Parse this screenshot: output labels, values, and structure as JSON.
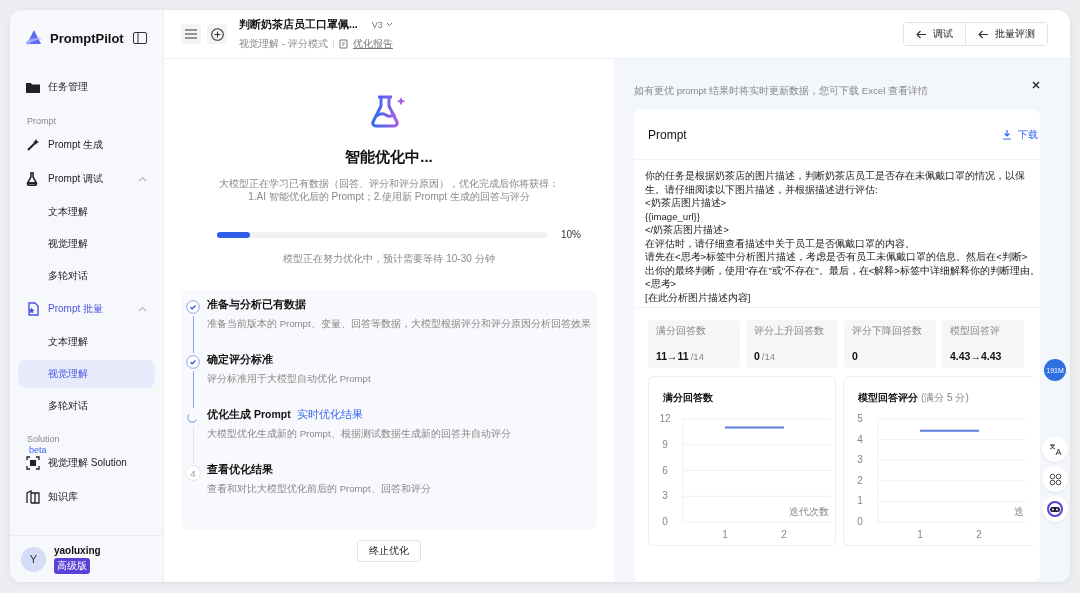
{
  "sidebar": {
    "logo": "PromptPilot",
    "nav": [
      {
        "kind": "item",
        "label": "任务管理",
        "selected": false
      },
      {
        "kind": "section",
        "label": "Prompt"
      },
      {
        "kind": "item",
        "label": "Prompt 生成",
        "selected": false
      },
      {
        "kind": "group",
        "label": "Prompt 调试",
        "expanded": true,
        "selected": false,
        "children": [
          {
            "label": "文本理解",
            "selected": false
          },
          {
            "label": "视觉理解",
            "selected": false
          },
          {
            "label": "多轮对话",
            "selected": false
          }
        ]
      },
      {
        "kind": "group",
        "label": "Prompt 批量",
        "expanded": true,
        "selected": true,
        "children": [
          {
            "label": "文本理解",
            "selected": false
          },
          {
            "label": "视觉理解",
            "selected": true
          },
          {
            "label": "多轮对话",
            "selected": false
          }
        ]
      },
      {
        "kind": "section",
        "label": "Solution"
      },
      {
        "kind": "item",
        "label": "视觉理解 Solution",
        "badge": "beta",
        "selected": false
      },
      {
        "kind": "item",
        "label": "知识库",
        "selected": false
      }
    ],
    "user": {
      "initial": "Y",
      "name": "yaoluxing",
      "plan": "高级版"
    }
  },
  "header": {
    "title": "判断奶茶店员工口罩佩...",
    "version": "V3",
    "subtitle": "视觉理解 - 评分模式",
    "report_link": "优化报告",
    "buttons": [
      "调试",
      "批量评测"
    ]
  },
  "progress": {
    "heading": "智能优化中...",
    "description": [
      "大模型正在学习已有数据（回答、评分和评分原因），优化完成后你将获得：",
      "1.AI 智能优化后的 Prompt；2.使用新 Prompt 生成的回答与评分"
    ],
    "level": 0.1,
    "reading": "10%",
    "note": "模型正在努力优化中，预计需要等待 10-30 分钟",
    "steps": [
      {
        "kind": "done",
        "title": "准备与分析已有数据",
        "description": "准备当前版本的 Prompt、变量、回答等数据，大模型根据评分和评分原因分析回答效果"
      },
      {
        "kind": "done",
        "title": "确定评分标准",
        "description": "评分标准用于大模型自动优化 Prompt"
      },
      {
        "kind": "running",
        "title": "优化生成 Prompt",
        "link": "实时优化结果",
        "description": "大模型优化生成新的 Prompt、根据测试数据生成新的回答并自动评分"
      },
      {
        "kind": "pending",
        "number": "4",
        "title": "查看优化结果",
        "description": "查看和对比大模型优化前后的 Prompt、回答和评分"
      }
    ],
    "stop_button": "终止优化"
  },
  "results": {
    "subtitle": "如有更优 prompt 结果时将实时更新数据，您可下载 Excel 查看详情",
    "prompt_card": {
      "title": "Prompt",
      "download": "下载",
      "lines": [
        "你的任务是根据奶茶店的图片描述，判断奶茶店员工是否存在未佩戴口罩的情况，以保",
        "生。请仔细阅读以下图片描述，并根据描述进行评估:",
        "<奶茶店图片描述>",
        "{{image_url}}",
        "</奶茶店图片描述>",
        "在评估时，请仔细查看描述中关于员工是否佩戴口罩的内容。",
        "请先在<思考>标签中分析图片描述，考虑是否有员工未佩戴口罩的信息。然后在<判断>",
        "出你的最终判断，使用\"存在\"或\"不存在\"。最后，在<解释>标签中详细解释你的判断理由。",
        "<思考>",
        "[在此分析图片描述内容]"
      ]
    },
    "stats": [
      {
        "label": "满分回答数",
        "value": "11→11",
        "total": "/14"
      },
      {
        "label": "评分上升回答数",
        "value": "0",
        "total": "/14"
      },
      {
        "label": "评分下降回答数",
        "value": "0"
      },
      {
        "label": "模型回答评",
        "value": "4.43→4.43"
      }
    ],
    "charts": [
      {
        "chart_data": {
          "type": "line",
          "title": "满分回答数",
          "xlabel": "迭代次数",
          "categories": [
            "1",
            "2"
          ],
          "series": [
            {
              "color": "#5b7fe0",
              "values": [
                11,
                11
              ]
            }
          ],
          "ylim": [
            0,
            12
          ],
          "yticks": [
            0,
            3,
            6,
            9,
            12
          ],
          "grid": true
        }
      },
      {
        "note": "(满分 5 分)",
        "chart_data": {
          "type": "line",
          "title": "模型回答评分",
          "xlabel": "迭",
          "categories": [
            "1",
            "2"
          ],
          "series": [
            {
              "color": "#5b7fe0",
              "values": [
                4.43,
                4.43
              ]
            }
          ],
          "ylim": [
            0,
            5
          ],
          "yticks": [
            0,
            1,
            2,
            3,
            4,
            5
          ],
          "grid": true
        }
      }
    ]
  },
  "float_tools": {
    "memory": "191M"
  }
}
